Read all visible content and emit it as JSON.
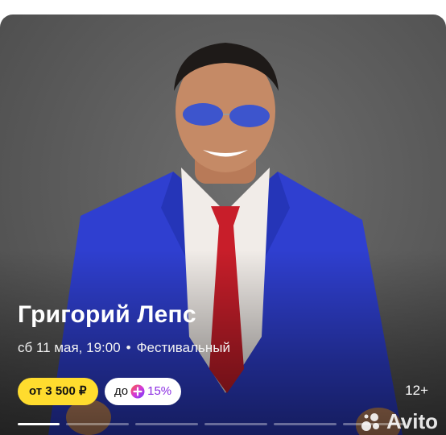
{
  "event": {
    "title": "Григорий Лепс",
    "date": "сб 11 мая, 19:00",
    "separator": "•",
    "venue": "Фестивальный",
    "price_label": "от 3 500 ₽",
    "cashback_prefix": "до",
    "cashback_percent": "15%",
    "age_rating": "12+"
  },
  "progress": {
    "total_slides": 6,
    "active_index": 0
  },
  "watermark": {
    "text": "Avito"
  },
  "colors": {
    "price_bg": "#ffdc2e",
    "cashback_accent": "#8a2be2",
    "jacket": "#2f3fd0",
    "tie": "#c81e2a"
  }
}
